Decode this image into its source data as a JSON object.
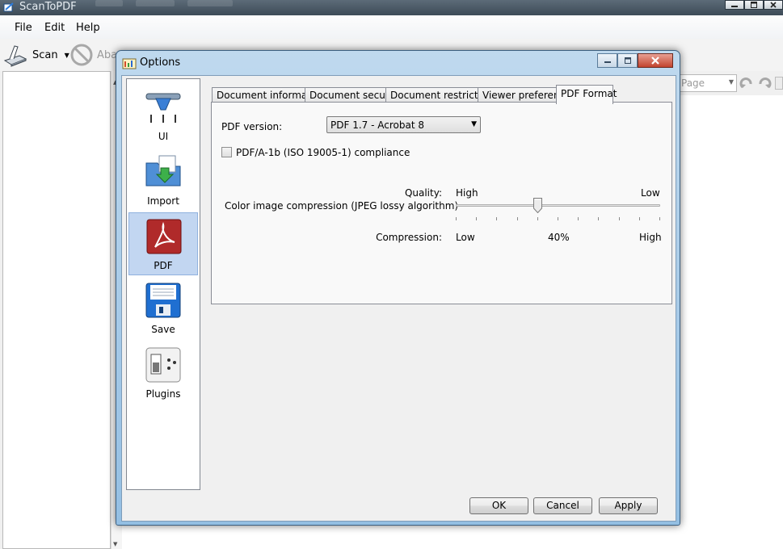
{
  "app": {
    "title": "ScanToPDF",
    "menu": [
      "File",
      "Edit",
      "Help"
    ],
    "toolbar": {
      "scan_label": "Scan",
      "abandon_label": "Abandon job"
    },
    "zoom": {
      "value": "Page"
    }
  },
  "dialog": {
    "title": "Options",
    "categories": [
      {
        "label": "UI",
        "icon": "scanner-icon"
      },
      {
        "label": "Import",
        "icon": "import-folder-icon"
      },
      {
        "label": "PDF",
        "icon": "acrobat-pdf-icon"
      },
      {
        "label": "Save",
        "icon": "floppy-disk-icon"
      },
      {
        "label": "Plugins",
        "icon": "plugin-switch-icon"
      }
    ],
    "selected_category": "PDF",
    "tabs": [
      "Document information",
      "Document security",
      "Document restrictions",
      "Viewer preference",
      "PDF Format"
    ],
    "active_tab": "PDF Format",
    "pdf_format": {
      "pdf_version_label": "PDF version:",
      "pdf_version_value": "PDF 1.7 - Acrobat 8",
      "pdfa_label": "PDF/A-1b (ISO 19005-1) compliance",
      "pdfa_checked": false,
      "quality_label": "Quality:",
      "quality_high": "High",
      "quality_low": "Low",
      "compression_section_label": "Color image compression (JPEG lossy algorithm)",
      "compression_label": "Compression:",
      "compression_low": "Low",
      "compression_high": "High",
      "compression_percent": "40%",
      "compression_fraction": 0.4
    },
    "buttons": {
      "ok": "OK",
      "cancel": "Cancel",
      "apply": "Apply"
    }
  },
  "colors": {
    "selection": "#c2d6f1",
    "dialog_frame": "#a9cdea",
    "app_titlebar": "#4a5966",
    "close_button": "#c84c36"
  }
}
